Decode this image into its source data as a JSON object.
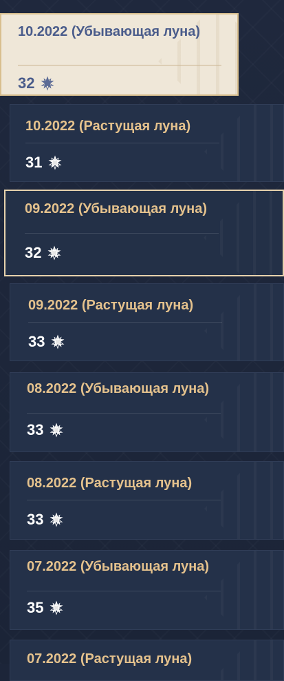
{
  "records": [
    {
      "title": "10.2022 (Убывающая луна)",
      "stars": "32",
      "icon": "star-icon"
    },
    {
      "title": "10.2022 (Растущая луна)",
      "stars": "31",
      "icon": "star-icon"
    },
    {
      "title": "09.2022 (Убывающая луна)",
      "stars": "32",
      "icon": "star-icon"
    },
    {
      "title": "09.2022 (Растущая луна)",
      "stars": "33",
      "icon": "star-icon"
    },
    {
      "title": "08.2022 (Убывающая луна)",
      "stars": "33",
      "icon": "star-icon"
    },
    {
      "title": "08.2022 (Растущая луна)",
      "stars": "33",
      "icon": "star-icon"
    },
    {
      "title": "07.2022 (Убывающая луна)",
      "stars": "35",
      "icon": "star-icon"
    },
    {
      "title": "07.2022 (Растущая луна)",
      "stars": "",
      "icon": ""
    }
  ],
  "colors": {
    "background": "#1c2539",
    "card": "#243149",
    "card_active": "#efe7d8",
    "title_gold": "#e5c28d",
    "title_active": "#4a5c8b",
    "stars_text": "#ffffff",
    "selected_border": "#e7d2ad"
  }
}
